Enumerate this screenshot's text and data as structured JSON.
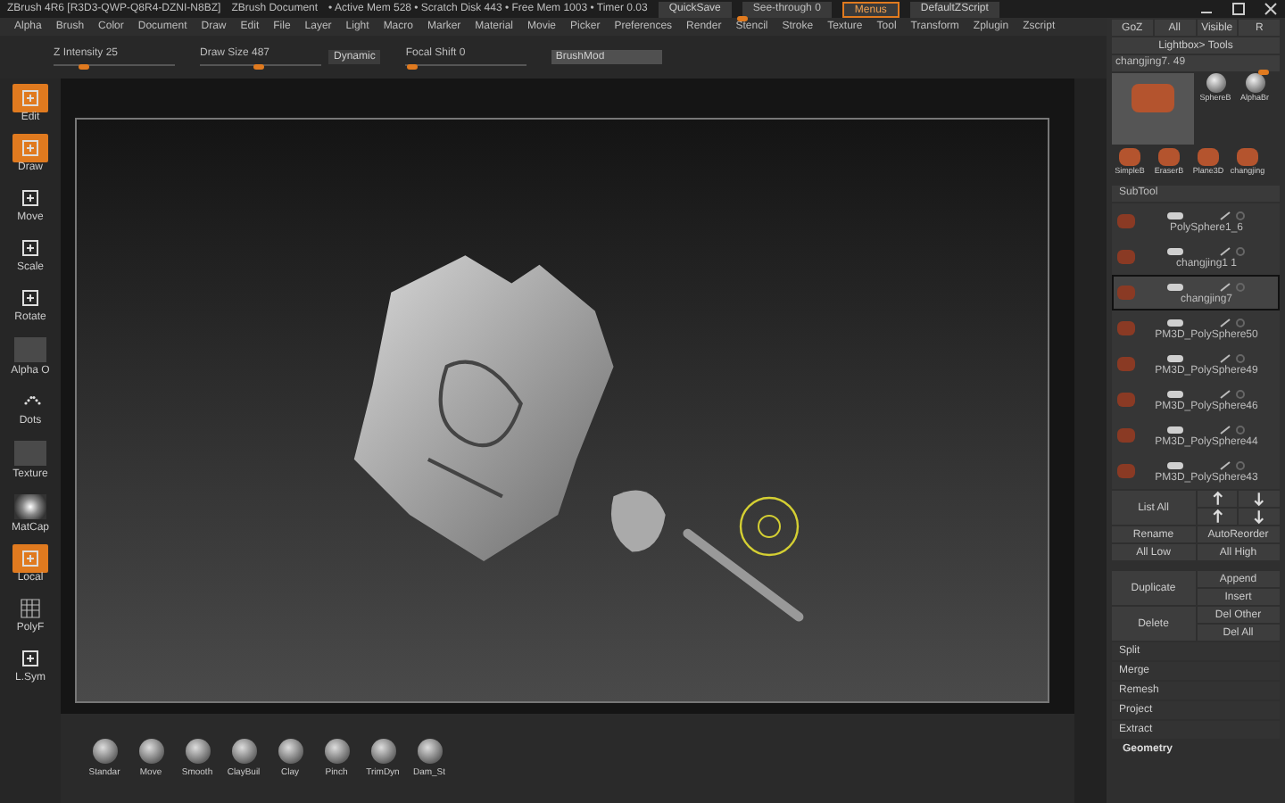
{
  "title_bar": {
    "app": "ZBrush 4R6 [R3D3-QWP-Q8R4-DZNI-N8BZ]",
    "document": "ZBrush Document",
    "stats": "• Active Mem 528 • Scratch Disk 443 • Free Mem 1003 • Timer 0.03",
    "quicksave": "QuickSave",
    "see_through": {
      "label": "See-through  0",
      "level": 0
    },
    "menus": {
      "label": "Menus",
      "on": true
    },
    "script": "DefaultZScript"
  },
  "menu_bar": [
    "Alpha",
    "Brush",
    "Color",
    "Document",
    "Draw",
    "Edit",
    "File",
    "Layer",
    "Light",
    "Macro",
    "Marker",
    "Material",
    "Movie",
    "Picker",
    "Preferences",
    "Render",
    "Stencil",
    "Stroke",
    "Texture",
    "Tool",
    "Transform",
    "Zplugin",
    "Zscript"
  ],
  "toolbar": {
    "items": [
      {
        "kind": "slider",
        "label": "Z Intensity 25",
        "level": 0.25
      },
      {
        "kind": "slider",
        "label": "Draw Size 487",
        "level": 0.49
      },
      {
        "kind": "button",
        "label": "Dynamic"
      },
      {
        "kind": "slider",
        "label": "Focal Shift 0",
        "level": 0.05
      },
      {
        "kind": "field",
        "value": "BrushMod"
      }
    ]
  },
  "left_shelf": [
    {
      "kind": "tool",
      "label": "Edit",
      "on": true
    },
    {
      "kind": "tool",
      "label": "Draw",
      "on": true
    },
    {
      "kind": "tool",
      "label": "Move",
      "on": false
    },
    {
      "kind": "tool",
      "label": "Scale",
      "on": false
    },
    {
      "kind": "tool",
      "label": "Rotate",
      "on": false
    },
    {
      "kind": "swatch",
      "label": "Alpha O",
      "on": false
    },
    {
      "kind": "dots",
      "label": "Dots",
      "on": false
    },
    {
      "kind": "swatch",
      "label": "Texture",
      "on": false
    },
    {
      "kind": "sphere",
      "label": "MatCap",
      "on": false
    },
    {
      "kind": "tool",
      "label": "Local",
      "on": true
    },
    {
      "kind": "grid",
      "label": "PolyF",
      "on": false
    },
    {
      "kind": "tool",
      "label": "L.Sym",
      "on": false
    }
  ],
  "brushes": [
    "Standar",
    "Move",
    "Smooth",
    "ClayBuil",
    "Clay",
    "Pinch",
    "TrimDyn",
    "Dam_St"
  ],
  "right_panel": {
    "top_row": [
      "GoZ",
      "All",
      "Visible",
      "R"
    ],
    "lightbox": "Lightbox> Tools",
    "tool_slider": {
      "label": "changjing7. 49",
      "level": 0.9
    },
    "tools": [
      {
        "kind": "model"
      },
      {
        "kind": "sphere",
        "label": "SphereB"
      },
      {
        "kind": "sphere",
        "label": "AlphaBr"
      },
      {
        "kind": "model",
        "label": "SimpleB"
      },
      {
        "kind": "model",
        "label": "EraserB"
      },
      {
        "kind": "model",
        "label": "Plane3D"
      },
      {
        "kind": "model",
        "label": "changjing"
      }
    ],
    "subtool": {
      "title": "SubTool",
      "items": [
        {
          "name": "PolySphere1_6",
          "selected": false
        },
        {
          "name": "changjing1 1",
          "selected": false
        },
        {
          "name": "changjing7",
          "selected": true
        },
        {
          "name": "PM3D_PolySphere50",
          "selected": false
        },
        {
          "name": "PM3D_PolySphere49",
          "selected": false
        },
        {
          "name": "PM3D_PolySphere46",
          "selected": false
        },
        {
          "name": "PM3D_PolySphere44",
          "selected": false
        },
        {
          "name": "PM3D_PolySphere43",
          "selected": false
        }
      ]
    },
    "list_all": "List All",
    "button_rows": [
      [
        "Rename",
        "AutoReorder"
      ],
      [
        "All Low",
        "All High"
      ]
    ],
    "duplicate": "Duplicate",
    "dup_side": [
      "Append",
      "Insert"
    ],
    "delete": "Delete",
    "del_side": [
      "Del Other",
      "Del All"
    ],
    "actions": [
      "Split",
      "Merge",
      "Remesh",
      "Project",
      "Extract"
    ],
    "geometry": "Geometry"
  }
}
